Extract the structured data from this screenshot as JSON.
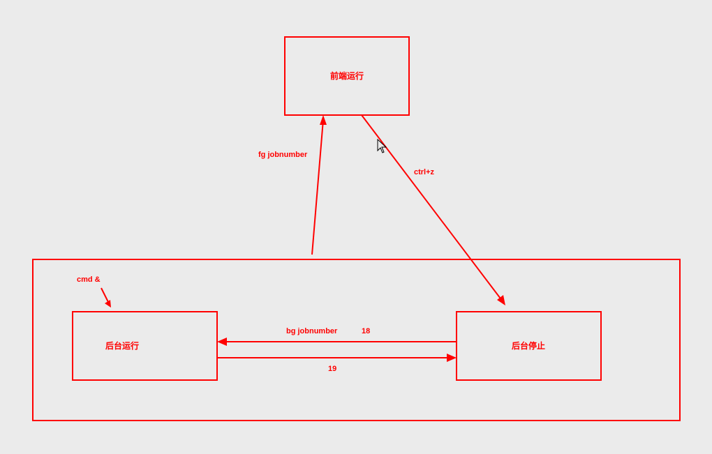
{
  "nodes": {
    "foreground": "前端运行",
    "bg_running": "后台运行",
    "bg_stopped": "后台停止"
  },
  "labels": {
    "fg_jobnumber": "fg  jobnumber",
    "ctrl_z": "ctrl+z",
    "cmd_amp": "cmd   &",
    "bg_jobnumber": "bg  jobnumber",
    "eighteen": "18",
    "nineteen": "19"
  },
  "colors": {
    "stroke": "#ff0000",
    "bg": "#ebebeb"
  }
}
